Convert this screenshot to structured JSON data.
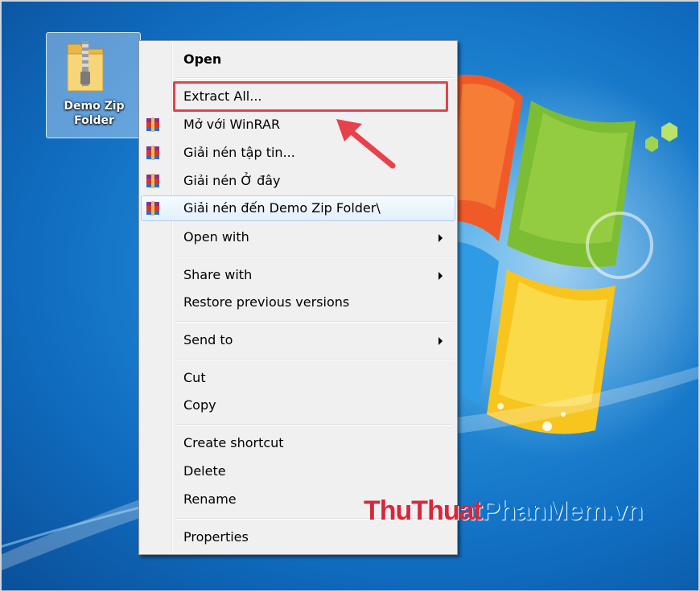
{
  "desktop": {
    "icon_label": "Demo Zip Folder"
  },
  "context_menu": {
    "items": [
      {
        "label": "Open",
        "bold": true
      },
      {
        "label": "Extract All..."
      },
      {
        "label": "Mở với WinRAR",
        "icon": "winrar-icon"
      },
      {
        "label": "Giải nén tập tin...",
        "icon": "winrar-icon"
      },
      {
        "label": "Giải nén Ở đây",
        "icon": "winrar-icon"
      },
      {
        "label": "Giải nén đến Demo Zip Folder\\",
        "icon": "winrar-icon",
        "hovered": true
      },
      {
        "label": "Open with",
        "submenu": true
      },
      {
        "label": "Share with",
        "submenu": true
      },
      {
        "label": "Restore previous versions"
      },
      {
        "label": "Send to",
        "submenu": true
      },
      {
        "label": "Cut"
      },
      {
        "label": "Copy"
      },
      {
        "label": "Create shortcut"
      },
      {
        "label": "Delete"
      },
      {
        "label": "Rename"
      },
      {
        "label": "Properties"
      }
    ]
  },
  "annotation": {
    "highlight_color": "#e8414b",
    "target_item": "Extract All..."
  },
  "watermark": {
    "part1": "ThuThuat",
    "part2": "PhanMem.vn"
  },
  "colors": {
    "accent_red": "#e8414b",
    "hover_border": "#b4cde8",
    "menu_bg": "#f0f0f0",
    "watermark_red": "#d9263a",
    "watermark_blue": "#0f74c9"
  }
}
